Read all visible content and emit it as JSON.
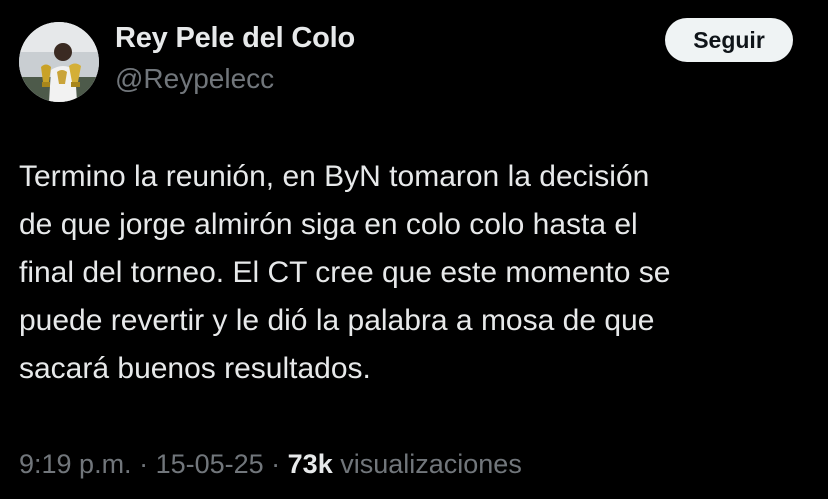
{
  "author": {
    "display_name": "Rey Pele del Colo",
    "handle": "@Reypelecc"
  },
  "follow_button": {
    "label": "Seguir"
  },
  "tweet": {
    "lines": [
      "Termino la reunión, en ByN tomaron la decisión",
      "de que jorge almirón siga en colo colo hasta el",
      "final del torneo. El CT cree que este momento se",
      "puede revertir y le dió la palabra a mosa de que",
      "sacará buenos resultados."
    ]
  },
  "meta": {
    "time": "9:19 p.m.",
    "separator": " · ",
    "date": "15-05-25",
    "views_count": "73k",
    "views_label": "visualizaciones"
  },
  "colors": {
    "background": "#000000",
    "primary_text": "#e7e9ea",
    "secondary_text": "#71767b",
    "button_bg": "#eff3f4",
    "button_text": "#0f1419"
  },
  "icons": {
    "avatar": "profile-photo-trophies"
  }
}
